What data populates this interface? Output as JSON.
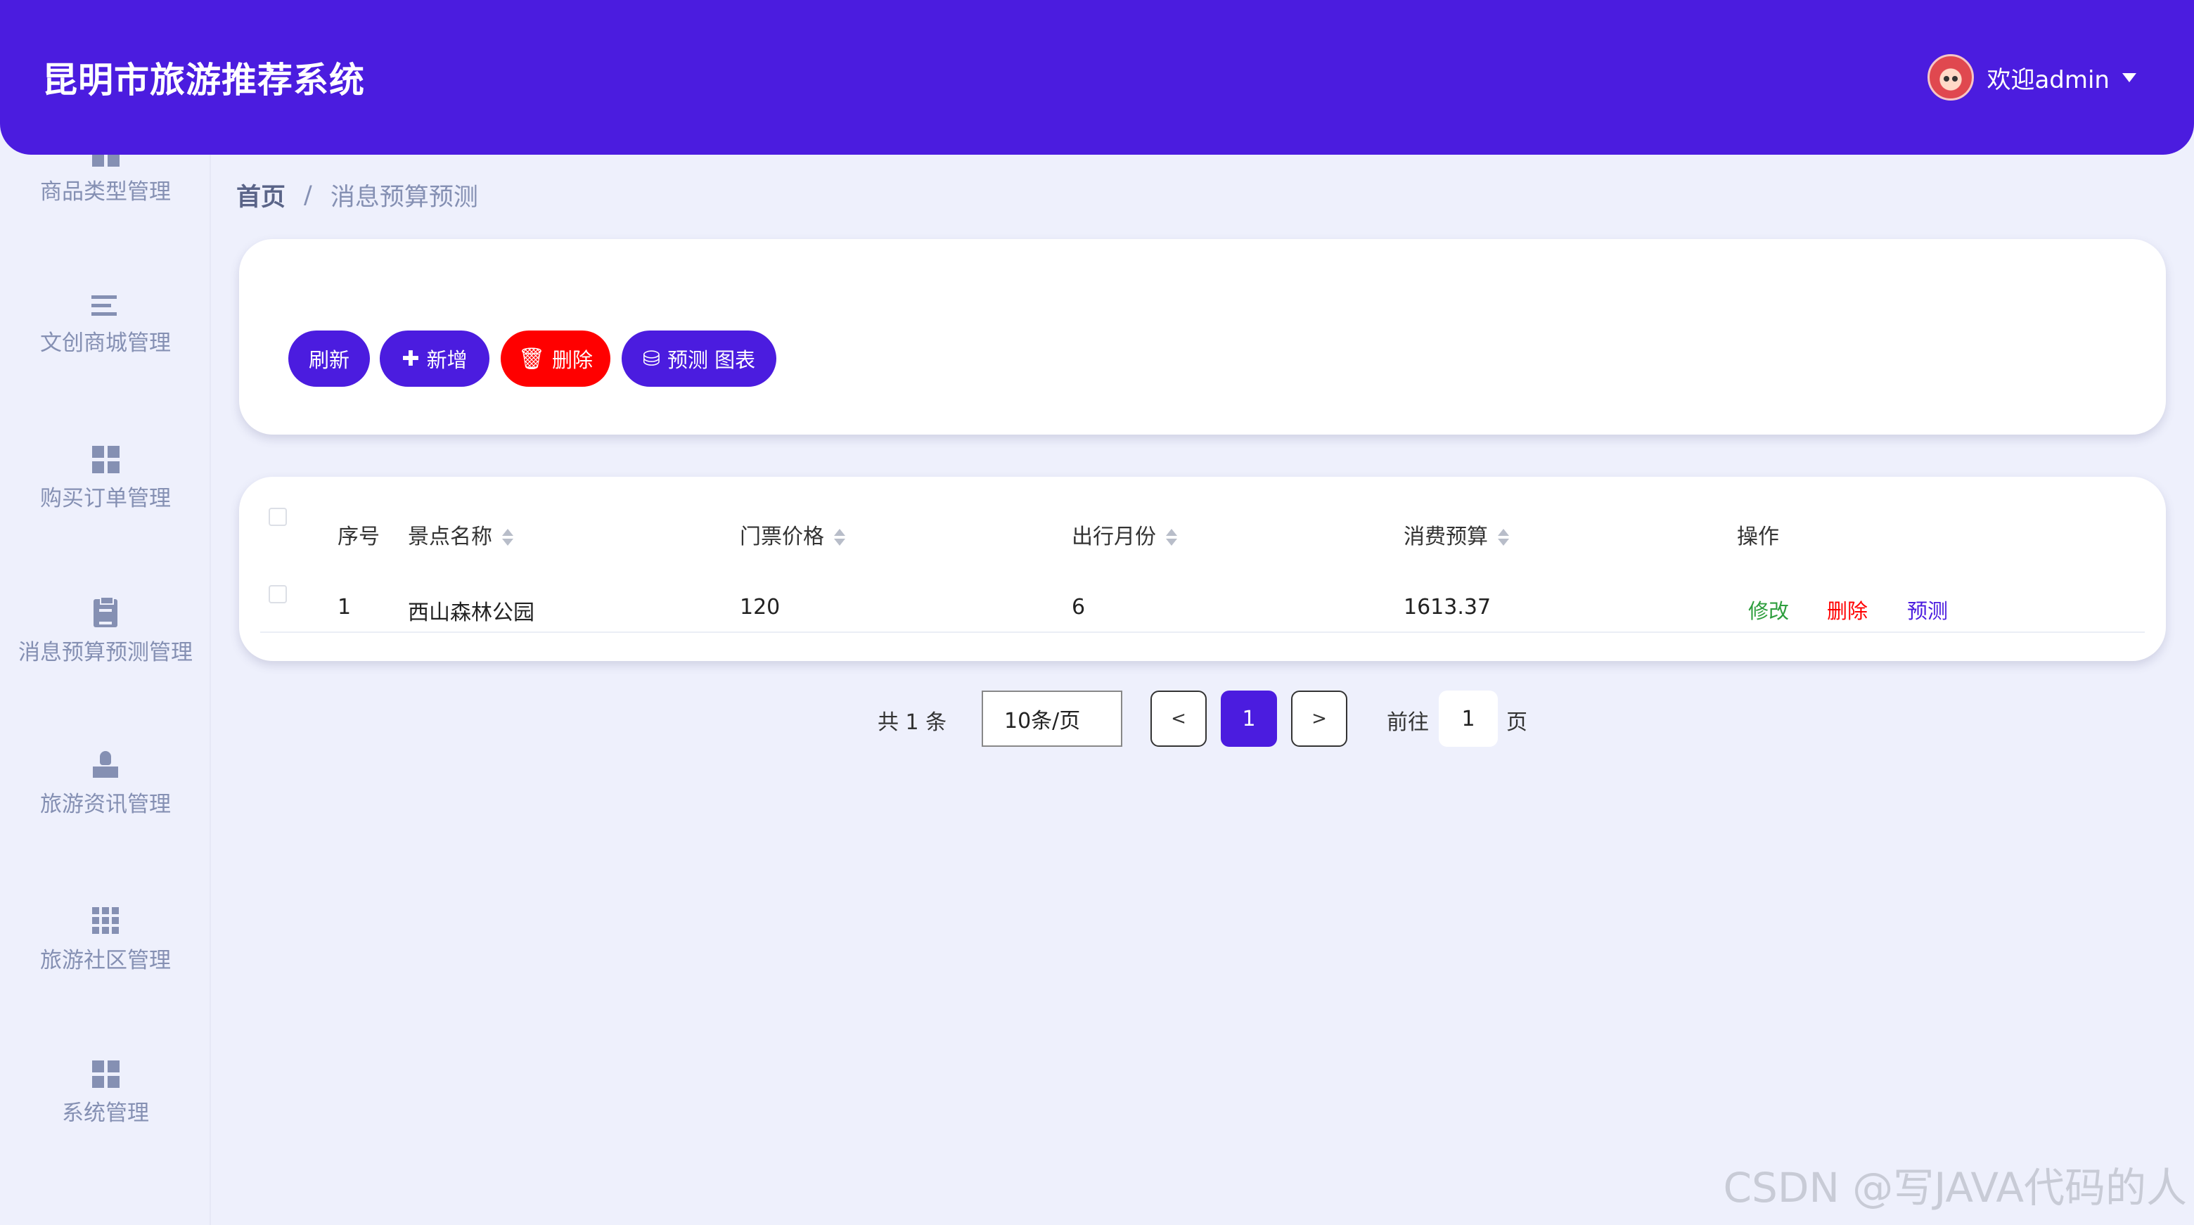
{
  "header": {
    "app_title": "昆明市旅游推荐系统",
    "welcome": "欢迎admin"
  },
  "sidebar": {
    "items": [
      {
        "label": "商品类型管理",
        "icon": "grid-icon"
      },
      {
        "label": "文创商城管理",
        "icon": "list-icon"
      },
      {
        "label": "购买订单管理",
        "icon": "grid-icon"
      },
      {
        "label": "消息预算预测管理",
        "icon": "clipboard-icon"
      },
      {
        "label": "旅游资讯管理",
        "icon": "stamp-icon"
      },
      {
        "label": "旅游社区管理",
        "icon": "grid9-icon"
      },
      {
        "label": "系统管理",
        "icon": "grid-icon"
      }
    ]
  },
  "breadcrumb": {
    "home": "首页",
    "separator": "/",
    "current": "消息预算预测"
  },
  "toolbar": {
    "refresh": "刷新",
    "add": "新增",
    "delete": "删除",
    "chart": "预测 图表"
  },
  "table": {
    "columns": [
      "序号",
      "景点名称",
      "门票价格",
      "出行月份",
      "消费预算",
      "操作"
    ],
    "rows": [
      {
        "index": "1",
        "name": "西山森林公园",
        "price": "120",
        "month": "6",
        "budget": "1613.37"
      }
    ],
    "actions": {
      "edit": "修改",
      "delete": "删除",
      "predict": "预测"
    }
  },
  "pagination": {
    "total": "共 1 条",
    "page_size": "10条/页",
    "prev": "<",
    "current_page": "1",
    "next": ">",
    "goto_prefix": "前往",
    "goto_value": "1",
    "goto_suffix": "页"
  },
  "watermark": "CSDN @写JAVA代码的人",
  "colors": {
    "primary": "#4b1cdf",
    "danger": "#ff0000",
    "edit_link": "#2e9e3e",
    "delete_link": "#ff0000",
    "predict_link": "#4b1cdf",
    "background": "#eef0fc"
  }
}
